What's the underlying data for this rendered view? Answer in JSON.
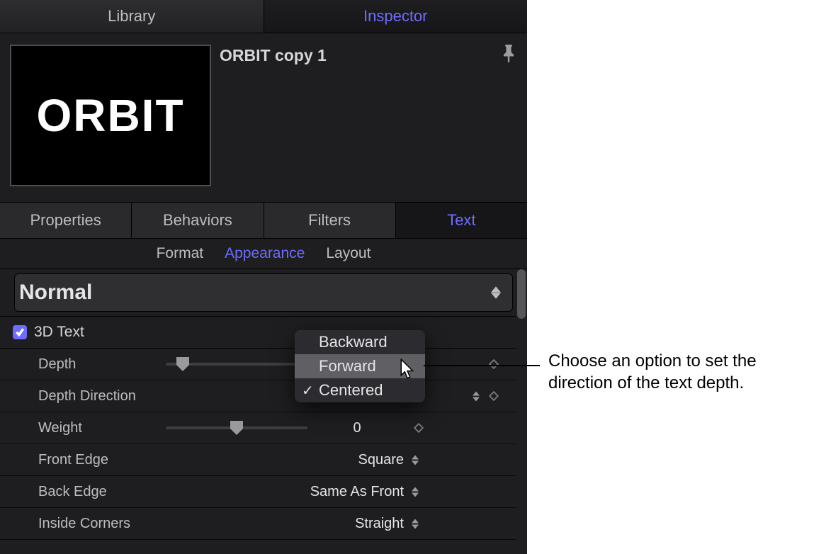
{
  "accentColor": "#6e6bff",
  "topTabs": {
    "library": "Library",
    "inspector": "Inspector"
  },
  "object": {
    "name": "ORBIT copy 1",
    "thumbnailText": "ORBIT"
  },
  "secondaryTabs": {
    "properties": "Properties",
    "behaviors": "Behaviors",
    "filters": "Filters",
    "text": "Text"
  },
  "subTabs": {
    "format": "Format",
    "appearance": "Appearance",
    "layout": "Layout"
  },
  "styleDropdown": {
    "value": "Normal"
  },
  "section3D": {
    "label": "3D Text",
    "enabled": true
  },
  "params": {
    "depth": {
      "label": "Depth",
      "sliderPos": 0.12
    },
    "depthDirection": {
      "label": "Depth Direction"
    },
    "weight": {
      "label": "Weight",
      "value": "0",
      "sliderPos": 0.5
    },
    "frontEdge": {
      "label": "Front Edge",
      "value": "Square"
    },
    "backEdge": {
      "label": "Back Edge",
      "value": "Same As Front"
    },
    "insideCorners": {
      "label": "Inside Corners",
      "value": "Straight"
    }
  },
  "popup": {
    "items": [
      {
        "label": "Backward",
        "checked": false,
        "highlight": false
      },
      {
        "label": "Forward",
        "checked": false,
        "highlight": true
      },
      {
        "label": "Centered",
        "checked": true,
        "highlight": false
      }
    ]
  },
  "callout": "Choose an option to set the direction of the text depth."
}
